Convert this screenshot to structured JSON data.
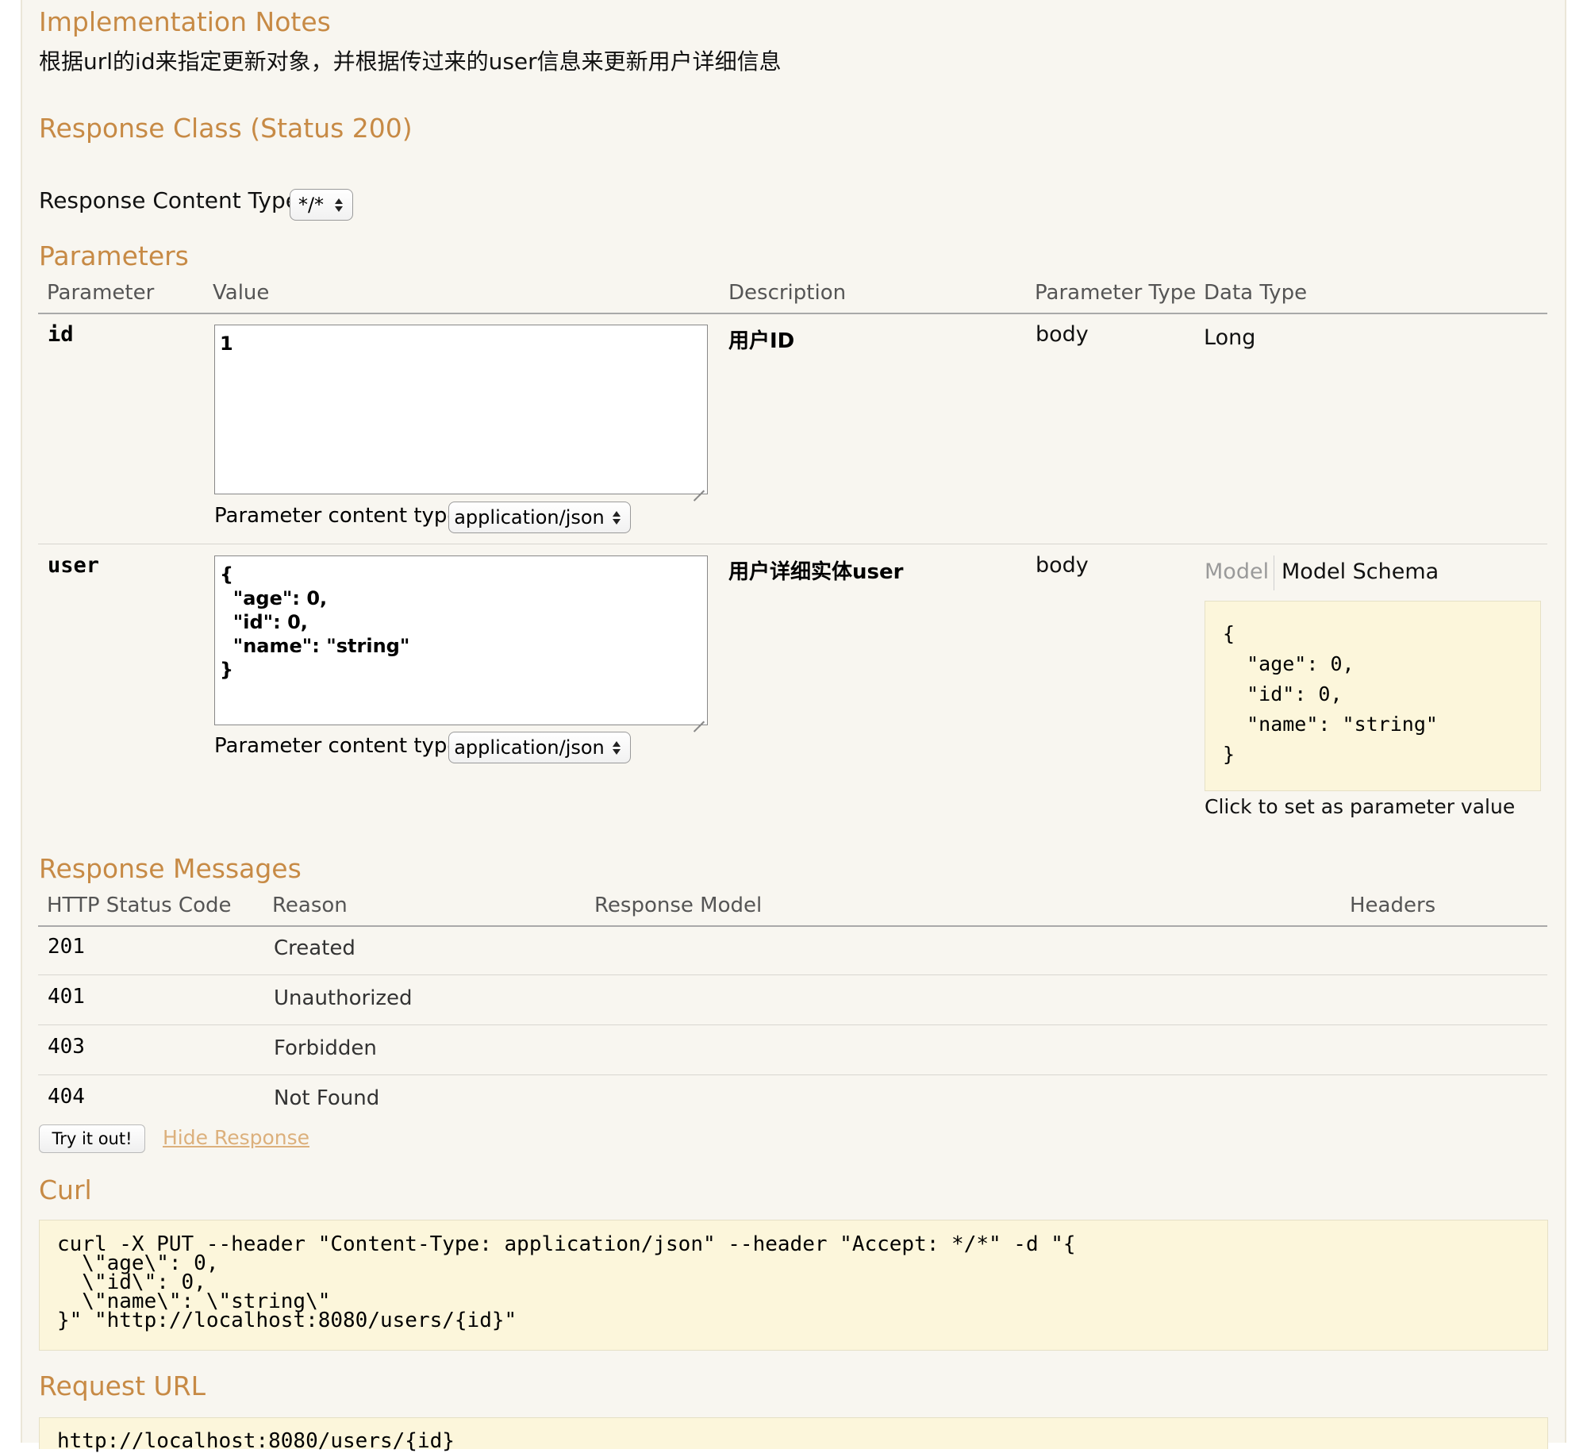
{
  "implementation_notes": {
    "heading": "Implementation Notes",
    "text": "根据url的id来指定更新对象，并根据传过来的user信息来更新用户详细信息"
  },
  "response_class": {
    "heading": "Response Class (Status 200)"
  },
  "response_content_type": {
    "label": "Response Content Type",
    "selected": "*/*"
  },
  "parameters": {
    "heading": "Parameters",
    "columns": [
      "Parameter",
      "Value",
      "Description",
      "Parameter Type",
      "Data Type"
    ],
    "content_type_label": "Parameter content type:",
    "rows": [
      {
        "name": "id",
        "value": "1",
        "description": "用户ID",
        "param_type": "body",
        "data_type": "Long",
        "content_type": "application/json"
      },
      {
        "name": "user",
        "value": "{\n  \"age\": 0,\n  \"id\": 0,\n  \"name\": \"string\"\n}",
        "description": "用户详细实体user",
        "param_type": "body",
        "content_type": "application/json",
        "model_tabs": [
          "Model",
          "Model Schema"
        ],
        "schema": "{\n  \"age\": 0,\n  \"id\": 0,\n  \"name\": \"string\"\n}",
        "click_hint": "Click to set as parameter value"
      }
    ]
  },
  "response_messages": {
    "heading": "Response Messages",
    "columns": [
      "HTTP Status Code",
      "Reason",
      "Response Model",
      "Headers"
    ],
    "rows": [
      {
        "code": "201",
        "reason": "Created"
      },
      {
        "code": "401",
        "reason": "Unauthorized"
      },
      {
        "code": "403",
        "reason": "Forbidden"
      },
      {
        "code": "404",
        "reason": "Not Found"
      }
    ]
  },
  "actions": {
    "try_label": "Try it out!",
    "hide_label": "Hide Response"
  },
  "curl": {
    "heading": "Curl",
    "command": "curl -X PUT --header \"Content-Type: application/json\" --header \"Accept: */*\" -d \"{\n  \\\"age\\\": 0,\n  \\\"id\\\": 0,\n  \\\"name\\\": \\\"string\\\"\n}\" \"http://localhost:8080/users/{id}\""
  },
  "request_url": {
    "heading": "Request URL",
    "url": "http://localhost:8080/users/{id}"
  },
  "colors": {
    "heading": "#c78a45",
    "panel_bg": "#f8f6f0",
    "code_bg": "#fcf6db"
  }
}
